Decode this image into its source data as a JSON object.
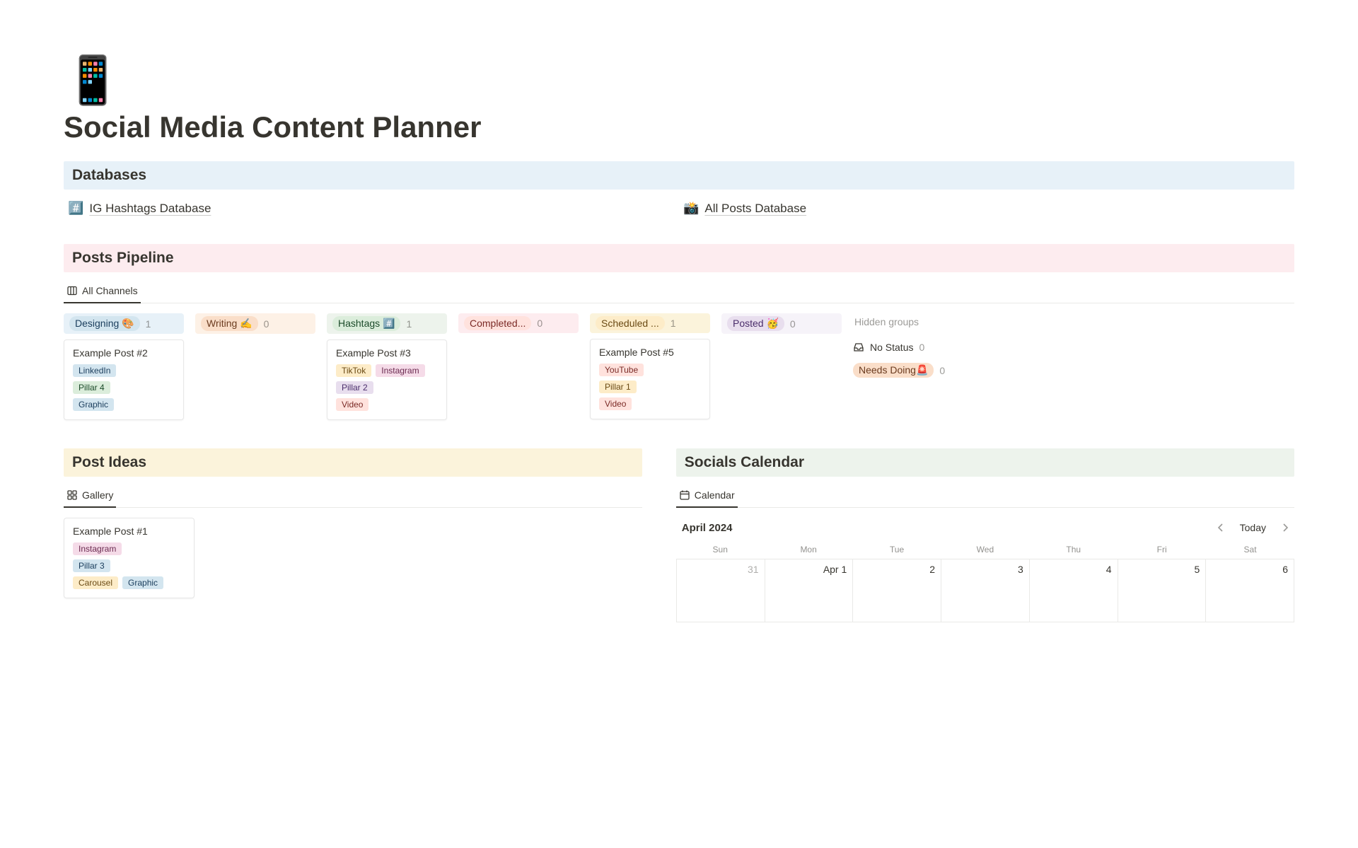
{
  "page": {
    "icon": "📱",
    "title": "Social Media Content Planner"
  },
  "sections": {
    "databases": "Databases",
    "pipeline": "Posts Pipeline",
    "ideas": "Post Ideas",
    "calendar": "Socials Calendar"
  },
  "databases": [
    {
      "emoji": "#️⃣",
      "label": "IG Hashtags Database"
    },
    {
      "emoji": "📸",
      "label": "All Posts Database"
    }
  ],
  "pipeline": {
    "tab_label": "All Channels",
    "columns": [
      {
        "label": "Designing 🎨",
        "count": 1,
        "label_class": "c-blue-lt",
        "head_class": "h-blue",
        "cards": [
          {
            "title": "Example Post #2",
            "rows": [
              [
                {
                  "text": "LinkedIn",
                  "class": "c-blue-lt"
                }
              ],
              [
                {
                  "text": "Pillar 4",
                  "class": "c-green-lt"
                }
              ],
              [
                {
                  "text": "Graphic",
                  "class": "c-blue-lt"
                }
              ]
            ]
          }
        ]
      },
      {
        "label": "Writing ✍️",
        "count": 0,
        "label_class": "c-orange-lt",
        "head_class": "h-orange",
        "cards": []
      },
      {
        "label": "Hashtags #️⃣",
        "count": 1,
        "label_class": "c-green-lt",
        "head_class": "h-green",
        "cards": [
          {
            "title": "Example Post #3",
            "rows": [
              [
                {
                  "text": "TikTok",
                  "class": "c-yellow-lt"
                },
                {
                  "text": "Instagram",
                  "class": "c-pink-lt"
                }
              ],
              [
                {
                  "text": "Pillar 2",
                  "class": "c-purple-lt"
                }
              ],
              [
                {
                  "text": "Video",
                  "class": "c-red-lt"
                }
              ]
            ]
          }
        ]
      },
      {
        "label": "Completed...",
        "count": 0,
        "label_class": "c-red-lt",
        "head_class": "h-red",
        "cards": []
      },
      {
        "label": "Scheduled ...",
        "count": 1,
        "label_class": "c-yellow-lt",
        "head_class": "h-yellow",
        "cards": [
          {
            "title": "Example Post #5",
            "rows": [
              [
                {
                  "text": "YouTube",
                  "class": "c-red-lt"
                }
              ],
              [
                {
                  "text": "Pillar 1",
                  "class": "c-yellow-lt"
                }
              ],
              [
                {
                  "text": "Video",
                  "class": "c-red-lt"
                }
              ]
            ]
          }
        ]
      },
      {
        "label": "Posted 🥳",
        "count": 0,
        "label_class": "c-purple-lt",
        "head_class": "h-purple",
        "cards": []
      }
    ],
    "hidden": {
      "title": "Hidden groups",
      "groups": [
        {
          "label": "No Status",
          "count": 0,
          "class": "",
          "icon": "inbox"
        },
        {
          "label": "Needs Doing🚨",
          "count": 0,
          "class": "c-orange-lt",
          "icon": ""
        }
      ]
    }
  },
  "ideas": {
    "tab_label": "Gallery",
    "cards": [
      {
        "title": "Example Post #1",
        "rows": [
          [
            {
              "text": "Instagram",
              "class": "c-pink-lt"
            }
          ],
          [
            {
              "text": "Pillar 3",
              "class": "c-blue-lt"
            }
          ],
          [
            {
              "text": "Carousel",
              "class": "c-yellow-lt"
            },
            {
              "text": "Graphic",
              "class": "c-blue-lt"
            }
          ]
        ]
      }
    ]
  },
  "calendar": {
    "tab_label": "Calendar",
    "month_label": "April 2024",
    "today_label": "Today",
    "dow": [
      "Sun",
      "Mon",
      "Tue",
      "Wed",
      "Thu",
      "Fri",
      "Sat"
    ],
    "cells": [
      {
        "text": "31",
        "dim": true
      },
      {
        "text": "Apr 1",
        "dim": false
      },
      {
        "text": "2",
        "dim": false
      },
      {
        "text": "3",
        "dim": false
      },
      {
        "text": "4",
        "dim": false
      },
      {
        "text": "5",
        "dim": false
      },
      {
        "text": "6",
        "dim": false
      }
    ]
  }
}
